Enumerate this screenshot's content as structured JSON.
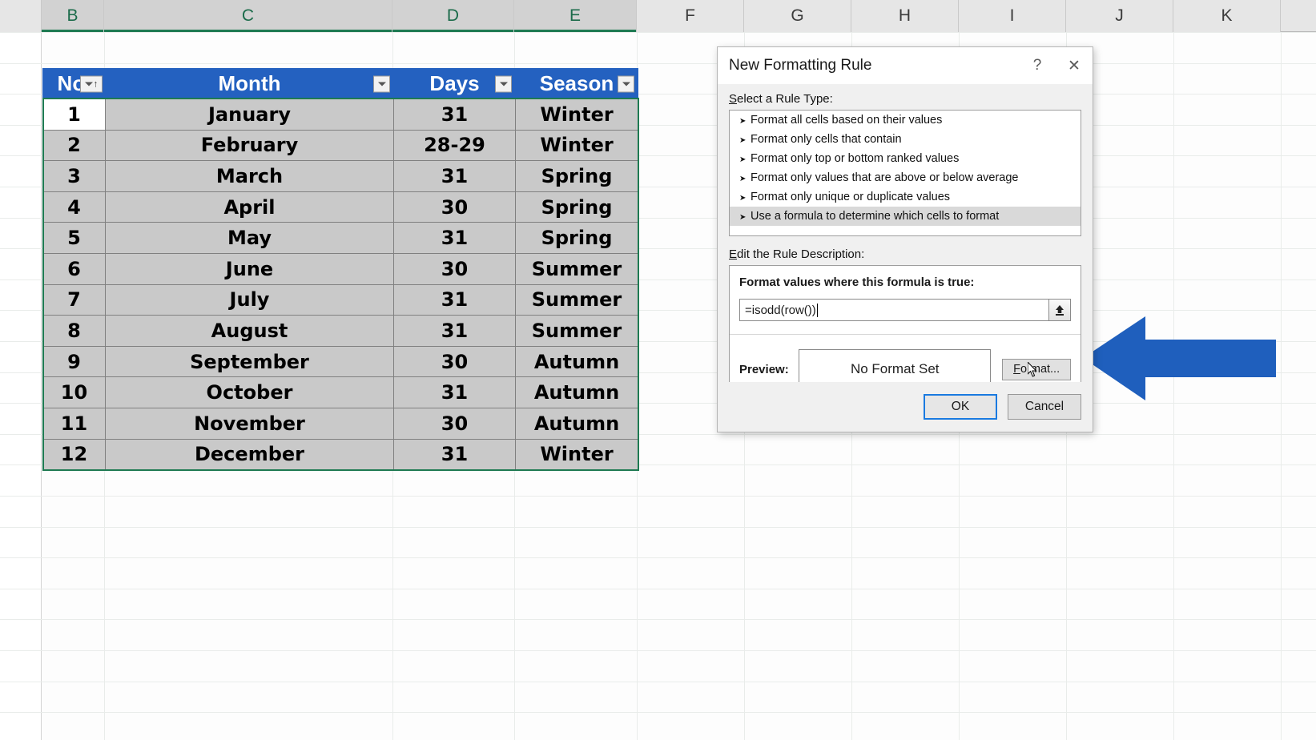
{
  "spreadsheet": {
    "column_headers": [
      "B",
      "C",
      "D",
      "E",
      "F",
      "G",
      "H",
      "I",
      "J",
      "K"
    ],
    "selected_columns": [
      "B",
      "C",
      "D",
      "E"
    ],
    "active_cell_value": "1",
    "table": {
      "headers": [
        "No.",
        "Month",
        "Days",
        "Season"
      ],
      "header_icons": [
        "sort-filter-icon",
        "filter-dropdown-icon",
        "filter-dropdown-icon",
        "filter-dropdown-icon"
      ],
      "header_fill": "#2461c0",
      "body_fill": "#c9c9c9",
      "rows": [
        [
          "1",
          "January",
          "31",
          "Winter"
        ],
        [
          "2",
          "February",
          "28-29",
          "Winter"
        ],
        [
          "3",
          "March",
          "31",
          "Spring"
        ],
        [
          "4",
          "April",
          "30",
          "Spring"
        ],
        [
          "5",
          "May",
          "31",
          "Spring"
        ],
        [
          "6",
          "June",
          "30",
          "Summer"
        ],
        [
          "7",
          "July",
          "31",
          "Summer"
        ],
        [
          "8",
          "August",
          "31",
          "Summer"
        ],
        [
          "9",
          "September",
          "30",
          "Autumn"
        ],
        [
          "10",
          "October",
          "31",
          "Autumn"
        ],
        [
          "11",
          "November",
          "30",
          "Autumn"
        ],
        [
          "12",
          "December",
          "31",
          "Winter"
        ]
      ]
    }
  },
  "dialog": {
    "title": "New Formatting Rule",
    "help_glyph": "?",
    "close_glyph": "✕",
    "rule_type_label": "Select a Rule Type:",
    "rule_types": [
      "Format all cells based on their values",
      "Format only cells that contain",
      "Format only top or bottom ranked values",
      "Format only values that are above or below average",
      "Format only unique or duplicate values",
      "Use a formula to determine which cells to format"
    ],
    "selected_rule_type_index": 5,
    "edit_description_label": "Edit the Rule Description:",
    "formula_heading": "Format values where this formula is true:",
    "formula_value": "=isodd(row())",
    "range_picker_glyph": "⬆",
    "preview_label": "Preview:",
    "preview_text": "No Format Set",
    "format_button": "Format...",
    "ok_button": "OK",
    "cancel_button": "Cancel"
  },
  "annotation": {
    "arrow_color": "#1f5fbd",
    "arrow_direction": "left",
    "points_at": "format-button"
  }
}
